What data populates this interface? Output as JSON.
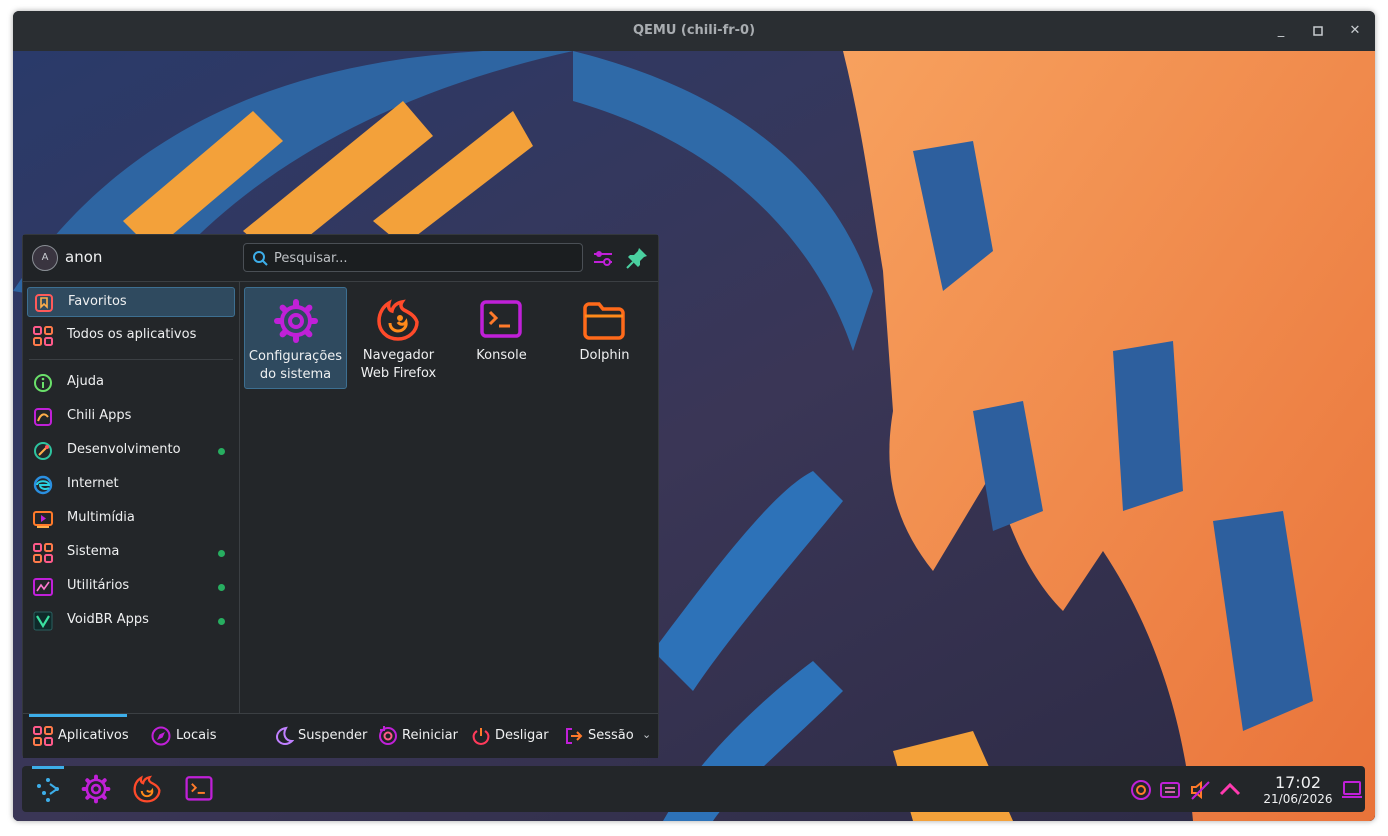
{
  "window": {
    "title": "QEMU (chili-fr-0)",
    "controls": {
      "minimize": "_",
      "maximize": "▫",
      "close": "✕"
    }
  },
  "launcher": {
    "user": {
      "initial": "A",
      "name": "anon"
    },
    "search": {
      "placeholder": "Pesquisar..."
    },
    "categories": [
      {
        "label": "Favoritos",
        "icon": "bookmark-icon",
        "active": true
      },
      {
        "label": "Todos os aplicativos",
        "icon": "apps-grid-icon"
      },
      {
        "label": "Ajuda",
        "icon": "help-icon"
      },
      {
        "label": "Chili Apps",
        "icon": "chili-apps-icon"
      },
      {
        "label": "Desenvolvimento",
        "icon": "development-icon",
        "new": true
      },
      {
        "label": "Internet",
        "icon": "internet-icon"
      },
      {
        "label": "Multimídia",
        "icon": "multimedia-icon"
      },
      {
        "label": "Sistema",
        "icon": "system-icon",
        "new": true
      },
      {
        "label": "Utilitários",
        "icon": "utilities-icon",
        "new": true
      },
      {
        "label": "VoidBR Apps",
        "icon": "voidbr-icon",
        "new": true
      }
    ],
    "favorites": [
      {
        "line1": "Configurações",
        "line2": "do sistema",
        "icon": "settings-gear-icon"
      },
      {
        "line1": "Navegador",
        "line2": "Web Firefox",
        "icon": "firefox-icon"
      },
      {
        "line1": "Konsole",
        "line2": "",
        "icon": "terminal-icon"
      },
      {
        "line1": "Dolphin",
        "line2": "",
        "icon": "folder-icon"
      }
    ],
    "footer": {
      "tabs": [
        {
          "label": "Aplicativos",
          "icon": "apps-grid-icon",
          "active": true
        },
        {
          "label": "Locais",
          "icon": "compass-icon"
        }
      ],
      "actions": [
        {
          "label": "Suspender",
          "icon": "moon-icon"
        },
        {
          "label": "Reiniciar",
          "icon": "restart-icon"
        },
        {
          "label": "Desligar",
          "icon": "power-icon"
        },
        {
          "label": "Sessão",
          "icon": "logout-icon"
        }
      ]
    }
  },
  "panel": {
    "clock": {
      "time": "17:02",
      "date": "21/06/2026"
    }
  },
  "colors": {
    "accent": "#3daee9",
    "panel_bg": "#232629",
    "new_dot": "#27ae60",
    "icon_magenta": "#c020d8",
    "icon_orange": "#ff6a1a"
  }
}
